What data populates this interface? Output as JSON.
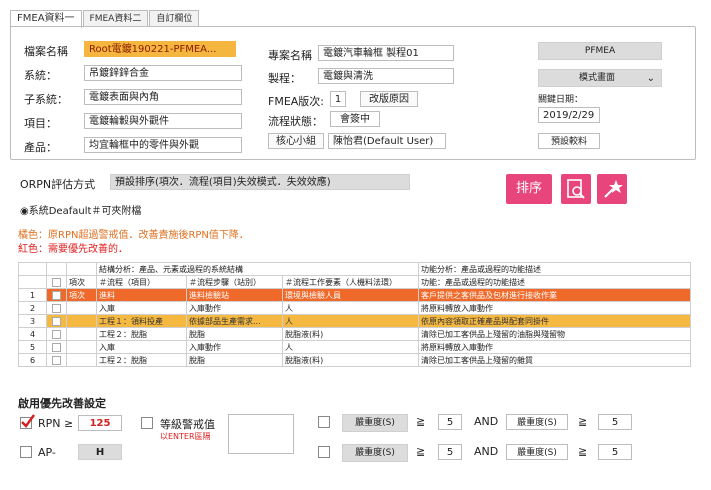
{
  "tabs": [
    "FMEA資料一",
    "FMEA資料二",
    "自訂欄位"
  ],
  "form": {
    "file_label": "檔案名稱",
    "file_value": "Root電鍍190221-PFMEA...",
    "system_label": "系統：",
    "system_value": "吊鍍鋅鋅合金",
    "subsystem_label": "子系統：",
    "subsystem_value": "電鍍表面與內角",
    "item_label": "項目：",
    "item_value": "電鍍輪轂與外觀件",
    "product_label": "產品：",
    "product_value": "均宜輪框中的零件與外觀",
    "project_label": "專案名稱",
    "project_value": "電鍍汽車輪框 製程01",
    "process_label": "製程：",
    "process_value": "電鍍與清洗",
    "version_label": "FMEA版次:",
    "version_value": "1",
    "reason_button": "改版原因",
    "status_label": "流程狀態：",
    "status_value": "會簽中",
    "core_team_button": "核心小組",
    "owner_value": "陳怡君(Default User)",
    "pfmea_button": "PFMEA",
    "mode_select": "模式畫面",
    "closing_date_label": "關鍵日期：",
    "closing_date_value": "2019/2/29",
    "preset_button": "預設較料"
  },
  "rpn": {
    "method_label": "ORPN評估方式",
    "method_value": "預設排序(項次．流程(項目)失效模式．失效效應)",
    "system_default_label": "◉系統Deafault＃可夾附檔",
    "sort_button": "排序",
    "note_orange": "橘色：原RPN超過警戒值．改善責施後RPN值下降．",
    "note_red": "紅色：需要優先改善的．"
  },
  "table": {
    "group_structure": "結構分析：產品、元素或過程的系統結構",
    "group_function": "功能分析：產品或過程的功能描述",
    "headers": [
      "項次",
      "＃流程（項目）",
      "＃流程步驟（站別）",
      "＃流程工作要素（人機料法環）",
      "功能：產品或過程的功能描述"
    ],
    "rows": [
      {
        "n": "1",
        "c1": "項次",
        "c2": "進料",
        "c3": "進料檢驗站",
        "c4": "環境與檢驗人員",
        "c5": "客戶提供之客供品及包材進行接收作業",
        "style": "orange"
      },
      {
        "n": "2",
        "c1": "",
        "c2": "入庫",
        "c3": "入庫動作",
        "c4": "人",
        "c5": "將原料轉放入庫動作",
        "style": ""
      },
      {
        "n": "3",
        "c1": "",
        "c2": "工程１：領料投產",
        "c3": "依據部品生產需求...",
        "c4": "人",
        "c5": "依原內容領取正確產品與配套同掛件",
        "style": "yellow"
      },
      {
        "n": "4",
        "c1": "",
        "c2": "工程２：脫脂",
        "c3": "脫脂",
        "c4": "脫脂液(料)",
        "c5": "清除已加工客供品上殘留的油脂與殘留物",
        "style": ""
      },
      {
        "n": "5",
        "c1": "",
        "c2": "入庫",
        "c3": "入庫動作",
        "c4": "人",
        "c5": "將原料轉放入庫動作",
        "style": ""
      },
      {
        "n": "6",
        "c1": "",
        "c2": "工程２：脫脂",
        "c3": "脫脂",
        "c4": "脫脂液(料)",
        "c5": "清除已加工客供品上殘留的雜質",
        "style": ""
      }
    ]
  },
  "priority": {
    "title": "啟用優先改善設定",
    "rpn_label": "RPN ≥",
    "rpn_value": "125",
    "ap_label": "AP-",
    "ap_value": "H",
    "warning_label": "等級警戒值",
    "enter_hint": "以ENTER區隔",
    "rule1": {
      "a_label": "嚴重度(S)",
      "op1": "≧",
      "v1": "5",
      "and": "AND",
      "b_label": "嚴重度(S)",
      "op2": "≧",
      "v2": "5"
    },
    "rule2": {
      "a_label": "嚴重度(S)",
      "op1": "≧",
      "v1": "5",
      "and": "AND",
      "b_label": "嚴重度(S)",
      "op2": "≧",
      "v2": "5"
    }
  },
  "colors": {
    "accent": "#e8457d",
    "orange": "#ef6a2a",
    "yellow": "#f5b942",
    "file_highlight": "#f4b63f"
  }
}
